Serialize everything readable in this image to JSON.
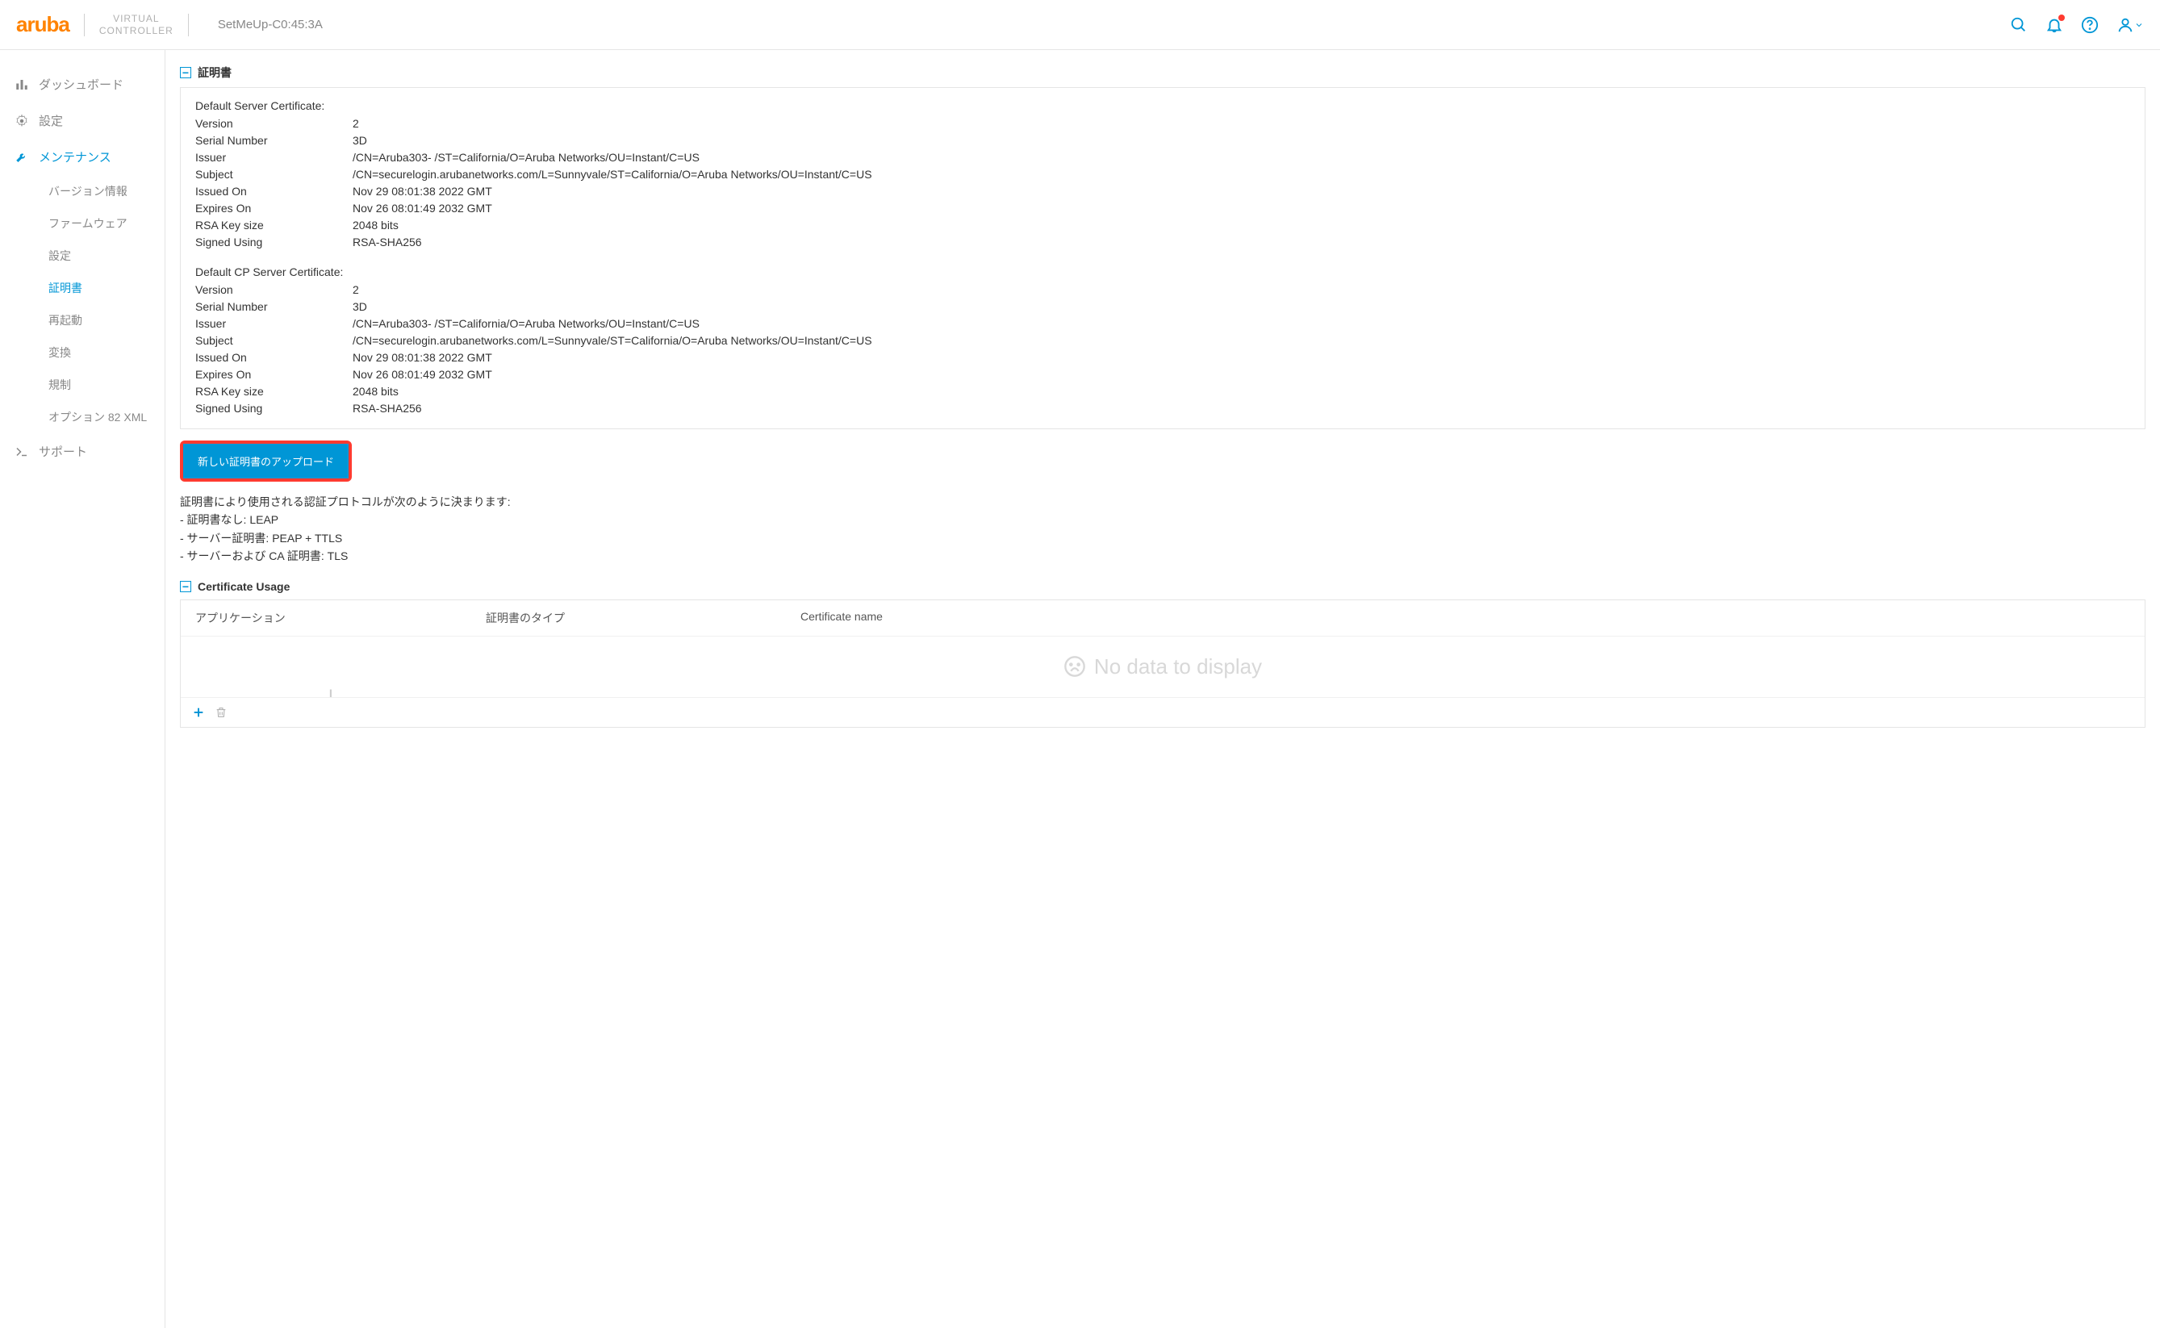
{
  "header": {
    "logo": "aruba",
    "vc_line1": "VIRTUAL",
    "vc_line2": "CONTROLLER",
    "hostname": "SetMeUp-C0:45:3A"
  },
  "nav": {
    "dashboard": "ダッシュボード",
    "settings": "設定",
    "maintenance": "メンテナンス",
    "support": "サポート",
    "sub": {
      "version": "バージョン情報",
      "firmware": "ファームウェア",
      "config": "設定",
      "cert": "証明書",
      "reboot": "再起動",
      "convert": "変換",
      "regulatory": "規制",
      "option82": "オプション 82 XML"
    }
  },
  "section": {
    "cert_title": "証明書",
    "usage_title": "Certificate Usage"
  },
  "certs": [
    {
      "heading": "Default Server Certificate:",
      "rows": [
        {
          "label": "Version",
          "value": "2"
        },
        {
          "label": "Serial Number",
          "value": "3D"
        },
        {
          "label": "Issuer",
          "value": "/CN=Aruba303-                  /ST=California/O=Aruba Networks/OU=Instant/C=US"
        },
        {
          "label": "Subject",
          "value": "/CN=securelogin.arubanetworks.com/L=Sunnyvale/ST=California/O=Aruba Networks/OU=Instant/C=US"
        },
        {
          "label": "Issued On",
          "value": "Nov 29 08:01:38 2022 GMT"
        },
        {
          "label": "Expires On",
          "value": "Nov 26 08:01:49 2032 GMT"
        },
        {
          "label": "RSA Key size",
          "value": "2048 bits"
        },
        {
          "label": "Signed Using",
          "value": "RSA-SHA256"
        }
      ]
    },
    {
      "heading": "Default CP Server Certificate:",
      "rows": [
        {
          "label": "Version",
          "value": "2"
        },
        {
          "label": "Serial Number",
          "value": "3D"
        },
        {
          "label": "Issuer",
          "value": "/CN=Aruba303-                  /ST=California/O=Aruba Networks/OU=Instant/C=US"
        },
        {
          "label": "Subject",
          "value": "/CN=securelogin.arubanetworks.com/L=Sunnyvale/ST=California/O=Aruba Networks/OU=Instant/C=US"
        },
        {
          "label": "Issued On",
          "value": "Nov 29 08:01:38 2022 GMT"
        },
        {
          "label": "Expires On",
          "value": "Nov 26 08:01:49 2032 GMT"
        },
        {
          "label": "RSA Key size",
          "value": "2048 bits"
        },
        {
          "label": "Signed Using",
          "value": "RSA-SHA256"
        }
      ]
    }
  ],
  "buttons": {
    "upload_cert": "新しい証明書のアップロード"
  },
  "help": {
    "intro": "証明書により使用される認証プロトコルが次のように決まります:",
    "line1": "- 証明書なし: LEAP",
    "line2": "- サーバー証明書: PEAP + TTLS",
    "line3": "- サーバーおよび CA 証明書: TLS"
  },
  "usage": {
    "col_app": "アプリケーション",
    "col_type": "証明書のタイプ",
    "col_name": "Certificate name",
    "no_data": "No data to display"
  }
}
